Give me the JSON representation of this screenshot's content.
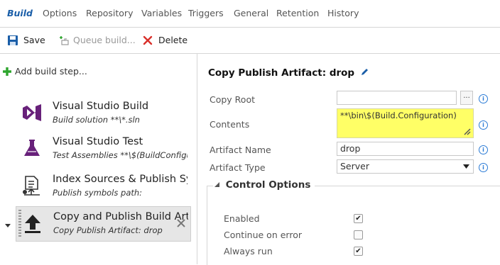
{
  "tabs": [
    "Build",
    "Options",
    "Repository",
    "Variables",
    "Triggers",
    "General",
    "Retention",
    "History"
  ],
  "toolbar": {
    "save": "Save",
    "queue": "Queue build...",
    "delete": "Delete"
  },
  "steps": {
    "add_label": "Add build step...",
    "items": [
      {
        "title": "Visual Studio Build",
        "subtitle": "Build solution **\\*.sln",
        "icon": "visual-studio-icon"
      },
      {
        "title": "Visual Studio Test",
        "subtitle": "Test Assemblies **\\$(BuildConfigurat",
        "icon": "flask-icon"
      },
      {
        "title": "Index Sources & Publish Symbols",
        "subtitle": "Publish symbols path:",
        "icon": "index-symbols-icon"
      },
      {
        "title": "Copy and Publish Build Artifacts",
        "subtitle": "Copy Publish Artifact: drop",
        "icon": "upload-icon"
      }
    ]
  },
  "details": {
    "heading": "Copy Publish Artifact: drop",
    "copy_root_label": "Copy Root",
    "copy_root_value": "",
    "browse_label": "...",
    "contents_label": "Contents",
    "contents_value": "**\\bin\\$(Build.Configuration)",
    "artifact_name_label": "Artifact Name",
    "artifact_name_value": "drop",
    "artifact_type_label": "Artifact Type",
    "artifact_type_value": "Server"
  },
  "control_options": {
    "title": "Control Options",
    "options": [
      {
        "label": "Enabled",
        "checked": true
      },
      {
        "label": "Continue on error",
        "checked": false
      },
      {
        "label": "Always run",
        "checked": true
      }
    ]
  },
  "colors": {
    "accent": "#1a5ea8",
    "highlight": "#ffff66",
    "add_green": "#2ea52e",
    "delete_red": "#d9302a",
    "vs_purple": "#68217a"
  }
}
